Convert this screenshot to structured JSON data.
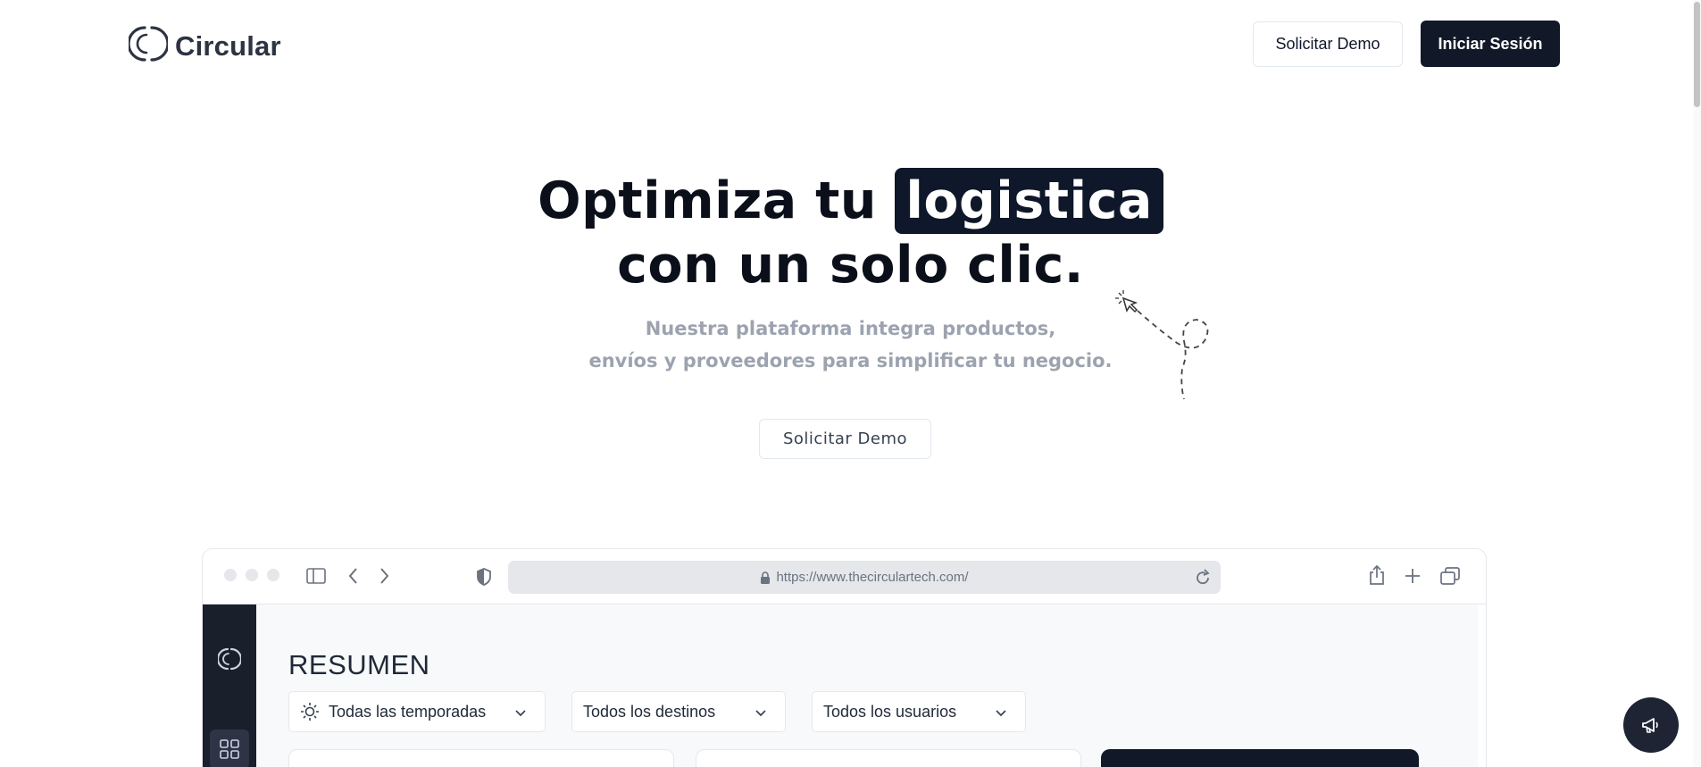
{
  "header": {
    "brand": "Circular",
    "demo_button": "Solicitar Demo",
    "login_button": "Iniciar Sesión"
  },
  "hero": {
    "title_part1": "Optimiza tu",
    "title_highlight": "logistica",
    "title_line2": "con un solo clic.",
    "subtitle_line1": "Nuestra plataforma integra productos,",
    "subtitle_line2": "envíos y proveedores para simplificar tu negocio.",
    "cta": "Solicitar Demo"
  },
  "browser": {
    "url": "https://www.thecirculartech.com/",
    "app": {
      "title": "RESUMEN",
      "filters": [
        {
          "label": "Todas las temporadas",
          "icon": "sun-icon"
        },
        {
          "label": "Todos los destinos"
        },
        {
          "label": "Todos los usuarios"
        }
      ]
    }
  },
  "colors": {
    "primary": "#111827",
    "highlight_bg": "#0f172a",
    "subtitle": "#9ca3af",
    "sidebar": "#1a1f2c"
  }
}
